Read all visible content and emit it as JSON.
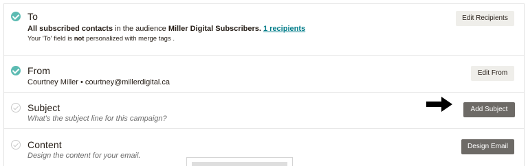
{
  "to": {
    "heading": "To",
    "line1_part1": "All subscribed contacts",
    "line1_part2": " in the audience ",
    "line1_audience": "Miller Digital Subscribers.",
    "line1_recipients": "1 recipients",
    "line2_part1": "Your 'To' field is ",
    "line2_not": "not",
    "line2_part2": " personalized with merge tags .",
    "button": "Edit Recipients"
  },
  "from": {
    "heading": "From",
    "sender": "Courtney Miller • courtney@millerdigital.ca",
    "button": "Edit From"
  },
  "subject": {
    "heading": "Subject",
    "prompt": "What's the subject line for this campaign?",
    "button": "Add Subject"
  },
  "content": {
    "heading": "Content",
    "prompt": "Design the content for your email.",
    "button": "Design Email"
  },
  "icons": {
    "complete": "check-circle-filled-icon",
    "incomplete": "check-circle-outline-icon",
    "pointer": "arrow-right-icon"
  },
  "colors": {
    "complete_check": "#5cbbb2",
    "link": "#007c89",
    "primary_button": "#6d6a66",
    "secondary_button": "#efeeea"
  }
}
